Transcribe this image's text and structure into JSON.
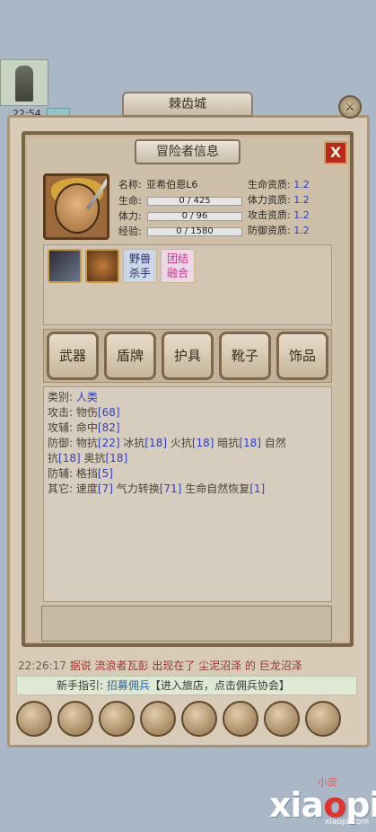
{
  "hud": {
    "time": "22:54"
  },
  "city": {
    "title": "棘齿城"
  },
  "panel": {
    "title": "冒险者信息",
    "close_label": "X",
    "name_label": "名称:",
    "name_value": "亚希伯恩L6",
    "hp_label": "生命:",
    "hp_value": "0 / 425",
    "stamina_label": "体力:",
    "stamina_value": "0 / 96",
    "exp_label": "经验:",
    "exp_value": "0 / 1580",
    "aptitude": [
      {
        "label": "生命资质:",
        "value": "1.2"
      },
      {
        "label": "体力资质:",
        "value": "1.2"
      },
      {
        "label": "攻击资质:",
        "value": "1.2"
      },
      {
        "label": "防御资质:",
        "value": "1.2"
      }
    ],
    "skills": [
      {
        "icon": "sword-skill-icon"
      },
      {
        "icon": "shield-skill-icon"
      },
      {
        "text": "野兽\n杀手"
      },
      {
        "text": "团结\n融合"
      }
    ],
    "skill_text_1_a": "野兽",
    "skill_text_1_b": "杀手",
    "skill_text_2_a": "团结",
    "skill_text_2_b": "融合",
    "equip": [
      "武器",
      "盾牌",
      "护具",
      "靴子",
      "饰品"
    ],
    "info": {
      "type_label": "类别:",
      "type_value": "人类",
      "attack_label": "攻击:",
      "attack_text": "物伤",
      "attack_value": "[68]",
      "assist_label": "攻辅:",
      "assist_text": "命中",
      "assist_value": "[82]",
      "defense_label": "防御:",
      "def_phys": "物抗",
      "def_phys_v": "[22]",
      "def_ice": "冰抗",
      "def_ice_v": "[18]",
      "def_fire": "火抗",
      "def_fire_v": "[18]",
      "def_dark": "暗抗",
      "def_dark_v": "[18]",
      "def_nature": "自然",
      "def_nature2": "抗",
      "def_nature_v": "[18]",
      "def_arcane": "奥抗",
      "def_arcane_v": "[18]",
      "defassist_label": "防辅:",
      "defassist_text": "格挡",
      "defassist_value": "[5]",
      "other_label": "其它:",
      "other_speed": "速度",
      "other_speed_v": "[7]",
      "other_qi": "气力转换",
      "other_qi_v": "[71]",
      "other_regen": "生命自然恢复",
      "other_regen_v": "[1]"
    }
  },
  "chat": {
    "time": "22:26:17",
    "text": "据说 流浪者瓦彭 出现在了 尘泥沼泽 的 巨龙沼泽"
  },
  "tip": {
    "label": "新手指引:",
    "link": "招募佣兵",
    "text": "【进入旅店，点击佣兵协会】"
  },
  "watermark": {
    "small": "小皮",
    "big_a": "xia",
    "big_b": "o",
    "big_c": "pi",
    "url": "xiaopi.com"
  },
  "colors": {
    "accent_blue": "#2d3fc0",
    "close_red": "#b8291b"
  }
}
